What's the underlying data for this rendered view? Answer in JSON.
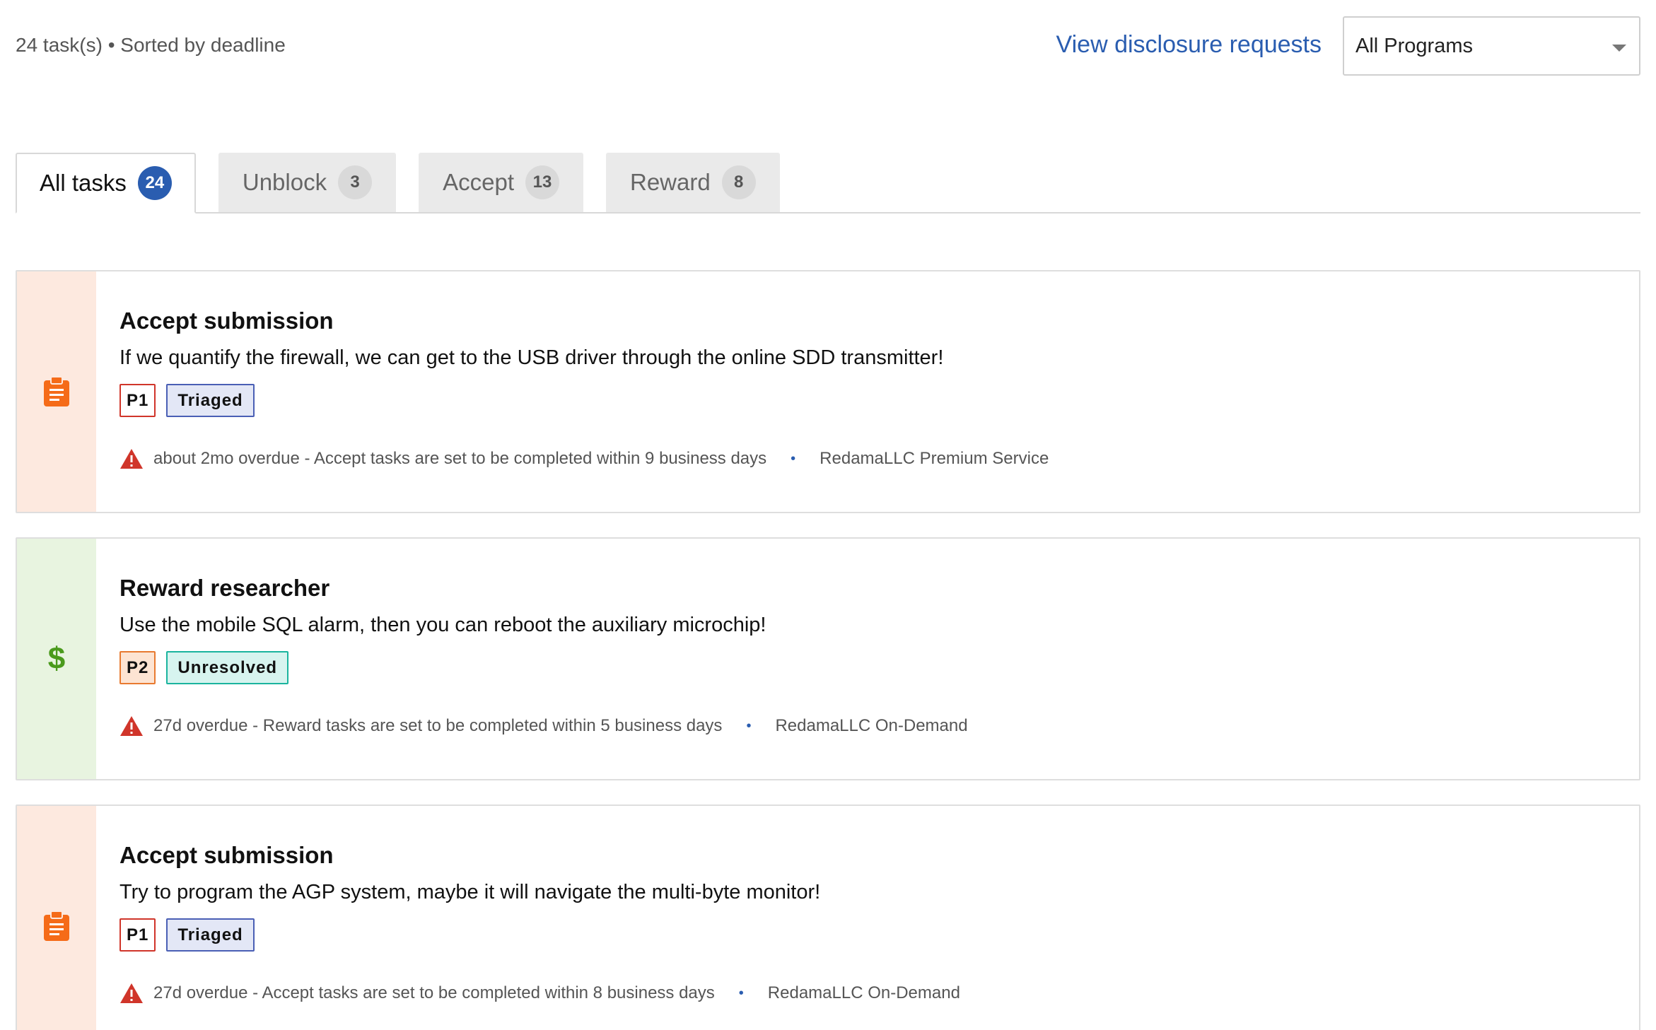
{
  "header": {
    "summary": "24 task(s) • Sorted by deadline",
    "disclosure_link": "View disclosure requests",
    "program_select": {
      "selected": "All Programs"
    }
  },
  "tabs": [
    {
      "label": "All tasks",
      "count": "24",
      "active": true
    },
    {
      "label": "Unblock",
      "count": "3",
      "active": false
    },
    {
      "label": "Accept",
      "count": "13",
      "active": false
    },
    {
      "label": "Reward",
      "count": "8",
      "active": false
    }
  ],
  "tasks": [
    {
      "type": "accept",
      "icon": "clipboard-icon",
      "title": "Accept submission",
      "description": "If we quantify the firewall, we can get to the USB driver through the online SDD transmitter!",
      "priority": "P1",
      "state": "Triaged",
      "deadline": "about 2mo overdue - Accept tasks are set to be completed within 9 business days",
      "program": "RedamaLLC Premium Service"
    },
    {
      "type": "reward",
      "icon": "dollar-icon",
      "icon_glyph": "$",
      "title": "Reward researcher",
      "description": "Use the mobile SQL alarm, then you can reboot the auxiliary microchip!",
      "priority": "P2",
      "state": "Unresolved",
      "deadline": "27d overdue - Reward tasks are set to be completed within 5 business days",
      "program": "RedamaLLC On-Demand"
    },
    {
      "type": "accept",
      "icon": "clipboard-icon",
      "title": "Accept submission",
      "description": "Try to program the AGP system, maybe it will navigate the multi-byte monitor!",
      "priority": "P1",
      "state": "Triaged",
      "deadline": "27d overdue - Accept tasks are set to be completed within 8 business days",
      "program": "RedamaLLC On-Demand"
    }
  ],
  "colors": {
    "link": "#2a5db0",
    "accept_rail": "#fde9df",
    "reward_rail": "#e8f4e0",
    "accept_icon": "#f56b18",
    "reward_icon": "#4a9a1c",
    "warning": "#d0352a"
  }
}
